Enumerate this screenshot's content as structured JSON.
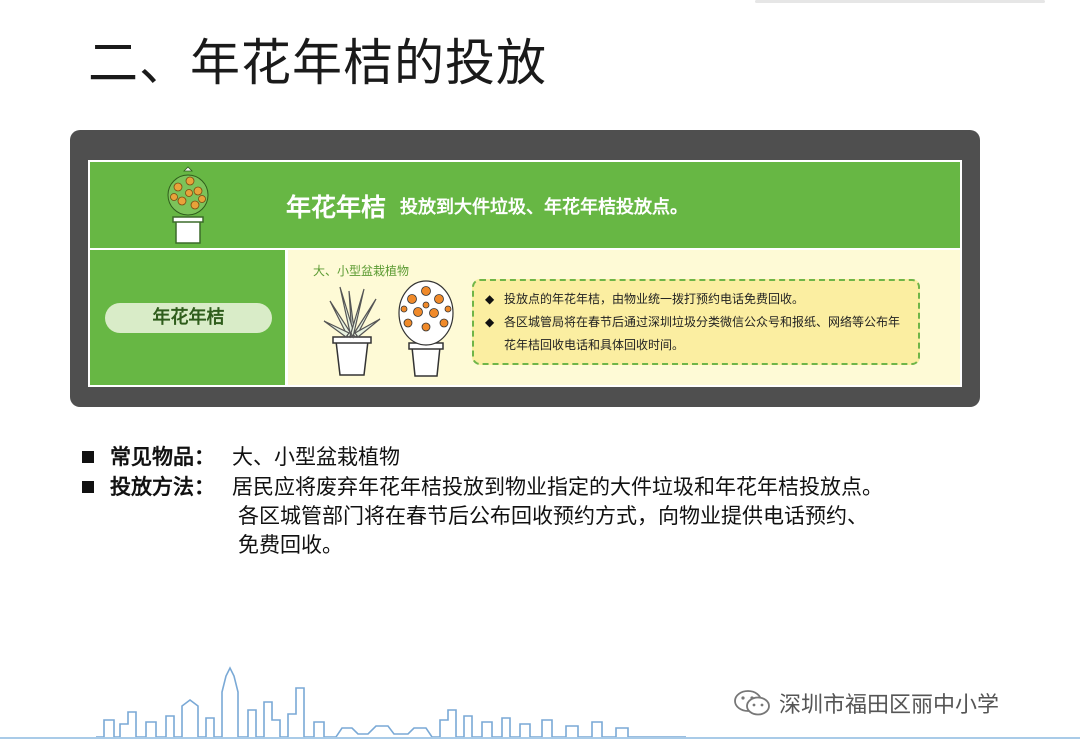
{
  "title": "二、年花年桔的投放",
  "card": {
    "band_title": "年花年桔",
    "band_desc": "投放到大件垃圾、年花年桔投放点。",
    "category_label": "年花年桔",
    "sub_label": "大、小型盆栽植物",
    "notes": [
      "投放点的年花年桔，由物业统一拨打预约电话免费回收。",
      "各区城管局将在春节后通过深圳垃圾分类微信公众号和报纸、网络等公布年",
      "花年桔回收电话和具体回收时间。"
    ],
    "bullet_glyph": "◆"
  },
  "body": {
    "items_label": "常见物品：",
    "items_text": "大、小型盆栽植物",
    "method_label": "投放方法：",
    "method_lines": [
      "居民应将废弃年花年桔投放到物业指定的大件垃圾和年花年桔投放点。",
      "各区城管部门将在春节后公布回收预约方式，向物业提供电话预约、",
      "免费回收。"
    ]
  },
  "watermark": {
    "icon": "wechat-icon",
    "text": "深圳市福田区丽中小学"
  },
  "colors": {
    "green": "#67b744",
    "frame": "#4f4f4f",
    "cream": "#fefad6",
    "note_fill": "#fbeea1",
    "pill": "#d9ecc8"
  }
}
